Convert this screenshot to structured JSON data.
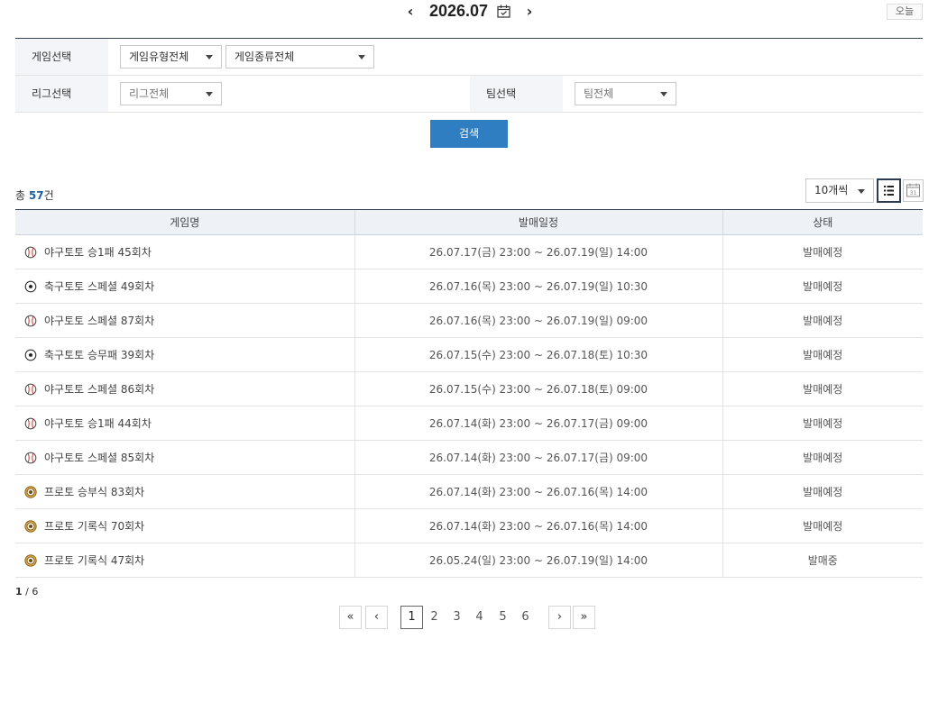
{
  "date_nav": {
    "prev_symbol": "‹",
    "month": "2026.07",
    "next_symbol": "›",
    "today_label": "오늘"
  },
  "search_form": {
    "game_select_label": "게임선택",
    "game_type_value": "게임유형전체",
    "game_kind_value": "게임종류전체",
    "league_select_label": "리그선택",
    "league_value": "리그전체",
    "team_select_label": "팀선택",
    "team_value": "팀전체",
    "search_button": "검색"
  },
  "results": {
    "total_prefix": "총 ",
    "total_count": "57",
    "total_suffix": "건",
    "per_page": "10개씩"
  },
  "table": {
    "headers": [
      "게임명",
      "발매일정",
      "상태"
    ],
    "rows": [
      {
        "icon": "baseball-icon",
        "name": "야구토토 승1패 45회차",
        "period": "26.07.17(금) 23:00 ~ 26.07.19(일) 14:00",
        "status": "발매예정"
      },
      {
        "icon": "soccer-icon",
        "name": "축구토토 스페셜 49회차",
        "period": "26.07.16(목) 23:00 ~ 26.07.19(일) 10:30",
        "status": "발매예정"
      },
      {
        "icon": "baseball-icon",
        "name": "야구토토 스페셜 87회차",
        "period": "26.07.16(목) 23:00 ~ 26.07.19(일) 09:00",
        "status": "발매예정"
      },
      {
        "icon": "soccer-icon",
        "name": "축구토토 승무패 39회차",
        "period": "26.07.15(수) 23:00 ~ 26.07.18(토) 10:30",
        "status": "발매예정"
      },
      {
        "icon": "baseball-icon",
        "name": "야구토토 스페셜 86회차",
        "period": "26.07.15(수) 23:00 ~ 26.07.18(토) 09:00",
        "status": "발매예정"
      },
      {
        "icon": "baseball-icon",
        "name": "야구토토 승1패 44회차",
        "period": "26.07.14(화) 23:00 ~ 26.07.17(금) 09:00",
        "status": "발매예정"
      },
      {
        "icon": "baseball-icon",
        "name": "야구토토 스페셜 85회차",
        "period": "26.07.14(화) 23:00 ~ 26.07.17(금) 09:00",
        "status": "발매예정"
      },
      {
        "icon": "proto-icon",
        "name": "프로토 승부식 83회차",
        "period": "26.07.14(화) 23:00 ~ 26.07.16(목) 14:00",
        "status": "발매예정"
      },
      {
        "icon": "proto-icon",
        "name": "프로토 기록식 70회차",
        "period": "26.07.14(화) 23:00 ~ 26.07.16(목) 14:00",
        "status": "발매예정"
      },
      {
        "icon": "proto-icon",
        "name": "프로토 기록식 47회차",
        "period": "26.05.24(일) 23:00 ~ 26.07.19(일) 14:00",
        "status": "발매중"
      }
    ]
  },
  "pagination": {
    "current": "1",
    "separator": " / ",
    "total": "6",
    "first": "«",
    "prev": "‹",
    "next": "›",
    "last": "»",
    "pages": [
      "1",
      "2",
      "3",
      "4",
      "5",
      "6"
    ]
  },
  "colors": {
    "accent": "#2f7ec1",
    "header_bg": "#eef2f7",
    "label_bg": "#f3f5f8"
  }
}
